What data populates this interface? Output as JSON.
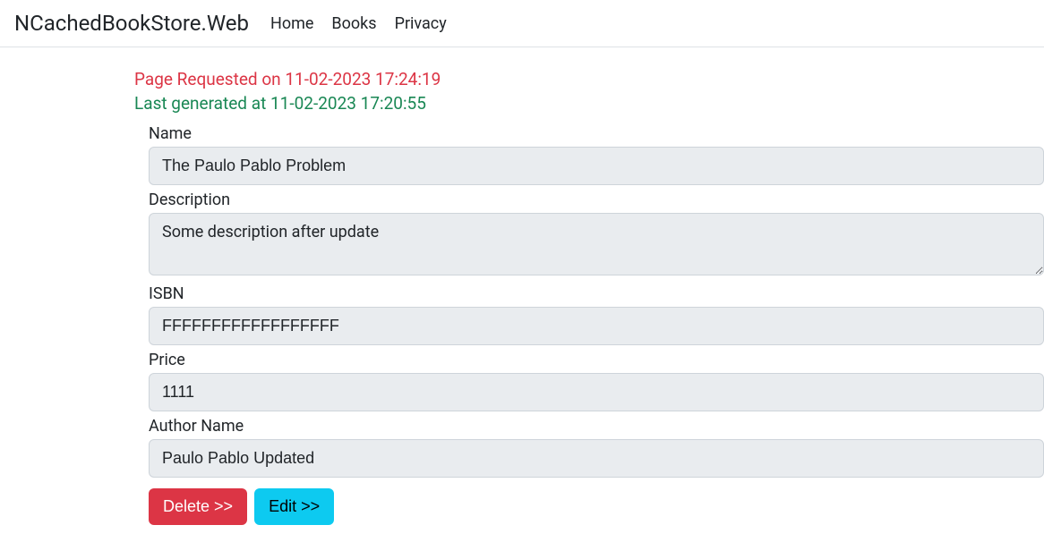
{
  "navbar": {
    "brand": "NCachedBookStore.Web",
    "links": {
      "home": "Home",
      "books": "Books",
      "privacy": "Privacy"
    }
  },
  "status": {
    "requested": "Page Requested on 11-02-2023 17:24:19",
    "generated": "Last generated at 11-02-2023 17:20:55"
  },
  "form": {
    "name": {
      "label": "Name",
      "value": "The Paulo Pablo Problem"
    },
    "description": {
      "label": "Description",
      "value": "Some description after update"
    },
    "isbn": {
      "label": "ISBN",
      "value": "FFFFFFFFFFFFFFFFFF"
    },
    "price": {
      "label": "Price",
      "value": "1111"
    },
    "author": {
      "label": "Author Name",
      "value": "Paulo Pablo Updated"
    }
  },
  "buttons": {
    "delete": "Delete >>",
    "edit": "Edit >>"
  }
}
